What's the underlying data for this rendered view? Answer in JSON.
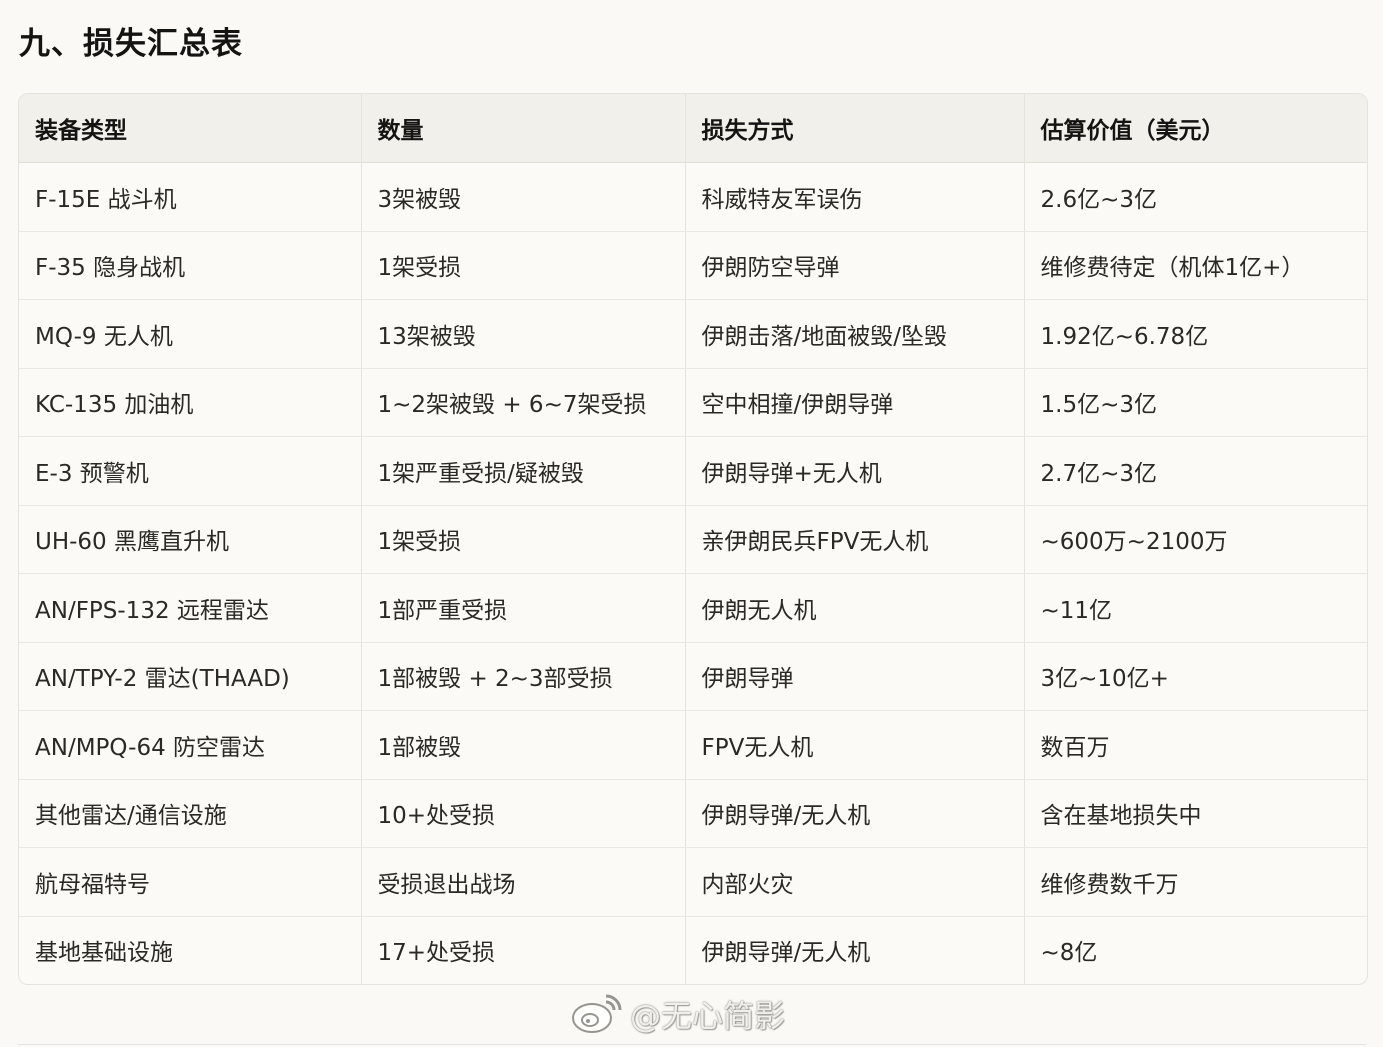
{
  "section": {
    "title": "九、损失汇总表"
  },
  "table": {
    "headers": [
      "装备类型",
      "数量",
      "损失方式",
      "估算价值（美元）"
    ],
    "rows": [
      [
        "F-15E 战斗机",
        "3架被毁",
        "科威特友军误伤",
        "2.6亿~3亿"
      ],
      [
        "F-35 隐身战机",
        "1架受损",
        "伊朗防空导弹",
        "维修费待定（机体1亿+）"
      ],
      [
        "MQ-9 无人机",
        "13架被毁",
        "伊朗击落/地面被毁/坠毁",
        "1.92亿~6.78亿"
      ],
      [
        "KC-135 加油机",
        "1~2架被毁 + 6~7架受损",
        "空中相撞/伊朗导弹",
        "1.5亿~3亿"
      ],
      [
        "E-3 预警机",
        "1架严重受损/疑被毁",
        "伊朗导弹+无人机",
        "2.7亿~3亿"
      ],
      [
        "UH-60 黑鹰直升机",
        "1架受损",
        "亲伊朗民兵FPV无人机",
        "~600万~2100万"
      ],
      [
        "AN/FPS-132 远程雷达",
        "1部严重受损",
        "伊朗无人机",
        "~11亿"
      ],
      [
        "AN/TPY-2 雷达(THAAD)",
        "1部被毁 + 2~3部受损",
        "伊朗导弹",
        "3亿~10亿+"
      ],
      [
        "AN/MPQ-64 防空雷达",
        "1部被毁",
        "FPV无人机",
        "数百万"
      ],
      [
        "其他雷达/通信设施",
        "10+处受损",
        "伊朗导弹/无人机",
        "含在基地损失中"
      ],
      [
        "航母福特号",
        "受损退出战场",
        "内部火灾",
        "维修费数千万"
      ],
      [
        "基地基础设施",
        "17+处受损",
        "伊朗导弹/无人机",
        "~8亿"
      ]
    ]
  },
  "watermark": {
    "text": "@无心简影",
    "icon": "weibo-logo-icon"
  }
}
